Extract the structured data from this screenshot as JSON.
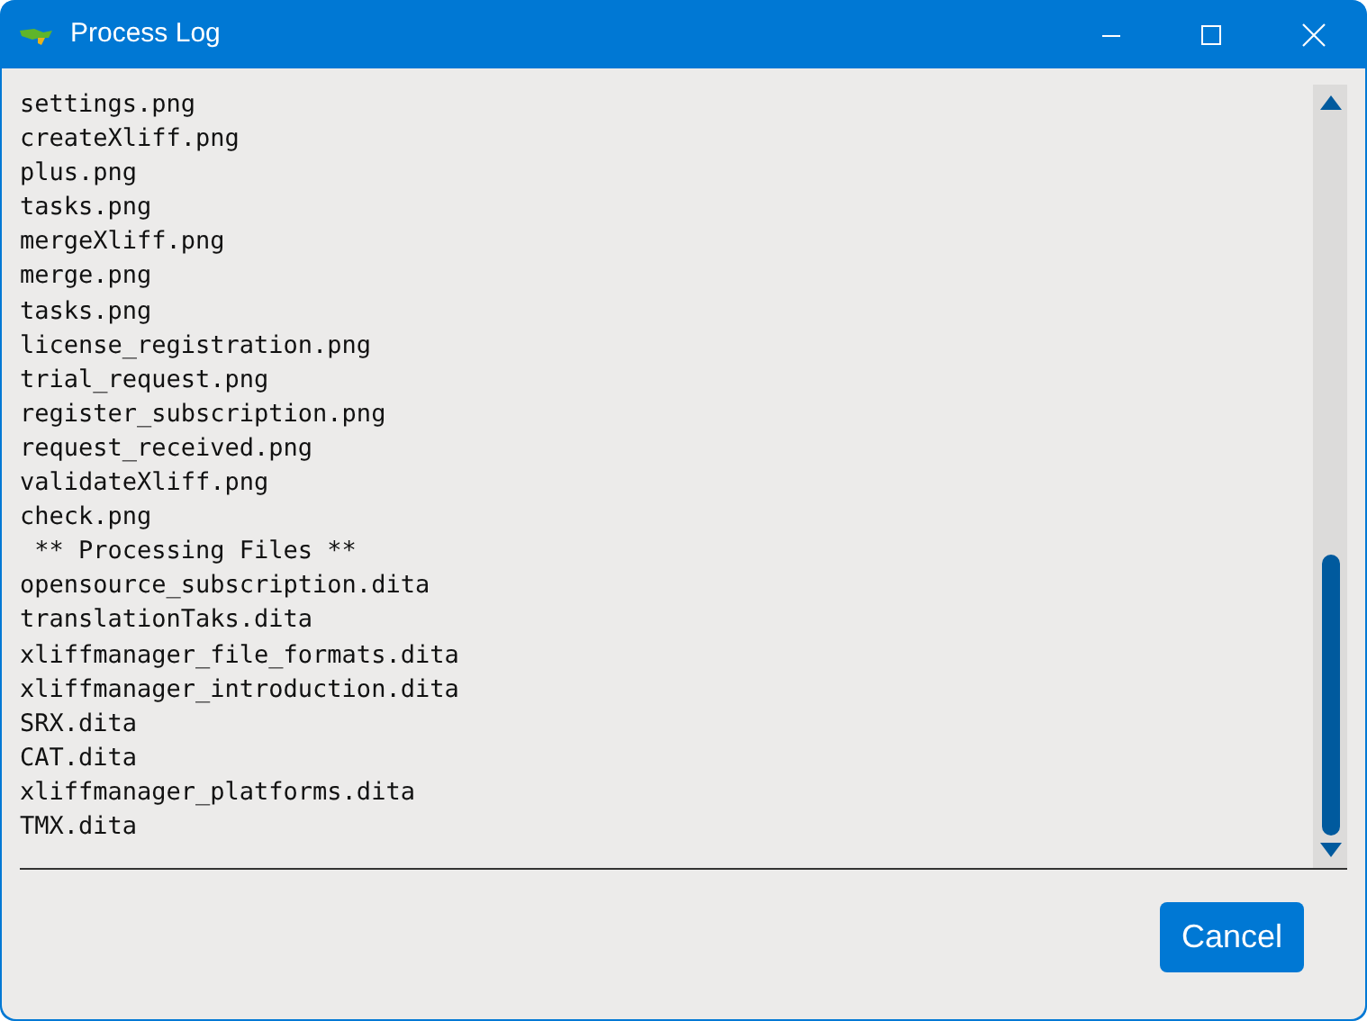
{
  "window": {
    "title": "Process Log"
  },
  "log_lines": [
    "settings.png",
    "createXliff.png",
    "plus.png",
    "tasks.png",
    "mergeXliff.png",
    "merge.png",
    "tasks.png",
    "license_registration.png",
    "trial_request.png",
    "register_subscription.png",
    "request_received.png",
    "validateXliff.png",
    "check.png",
    " ** Processing Files **",
    "opensource_subscription.dita",
    "translationTaks.dita",
    "xliffmanager_file_formats.dita",
    "xliffmanager_introduction.dita",
    "SRX.dita",
    "CAT.dita",
    "xliffmanager_platforms.dita",
    "TMX.dita"
  ],
  "buttons": [
    "Cancel"
  ]
}
